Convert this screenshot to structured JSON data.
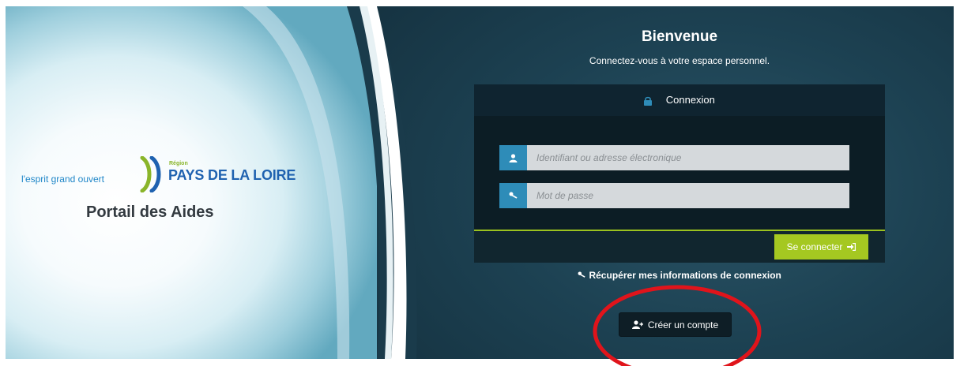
{
  "brand": {
    "tagline": "l'esprit grand ouvert",
    "region_small": "Région",
    "region_name": "PAYS DE LA LOIRE",
    "portal_title": "Portail des Aides"
  },
  "welcome": {
    "title": "Bienvenue",
    "subtitle": "Connectez-vous à votre espace personnel."
  },
  "login": {
    "header": "Connexion",
    "username_placeholder": "Identifiant ou adresse électronique",
    "password_placeholder": "Mot de passe",
    "submit_label": "Se connecter"
  },
  "links": {
    "recover": "Récupérer mes informations de connexion",
    "create_account": "Créer un compte"
  },
  "icons": {
    "lock": "lock-icon",
    "user": "user-icon",
    "key": "key-icon",
    "sign_in": "sign-in-icon",
    "user_plus": "user-plus-icon"
  },
  "colors": {
    "accent_green": "#a5c821",
    "field_icon_blue": "#2e8cb8",
    "brand_blue": "#1f62b0",
    "annotation_red": "#e0141b"
  }
}
